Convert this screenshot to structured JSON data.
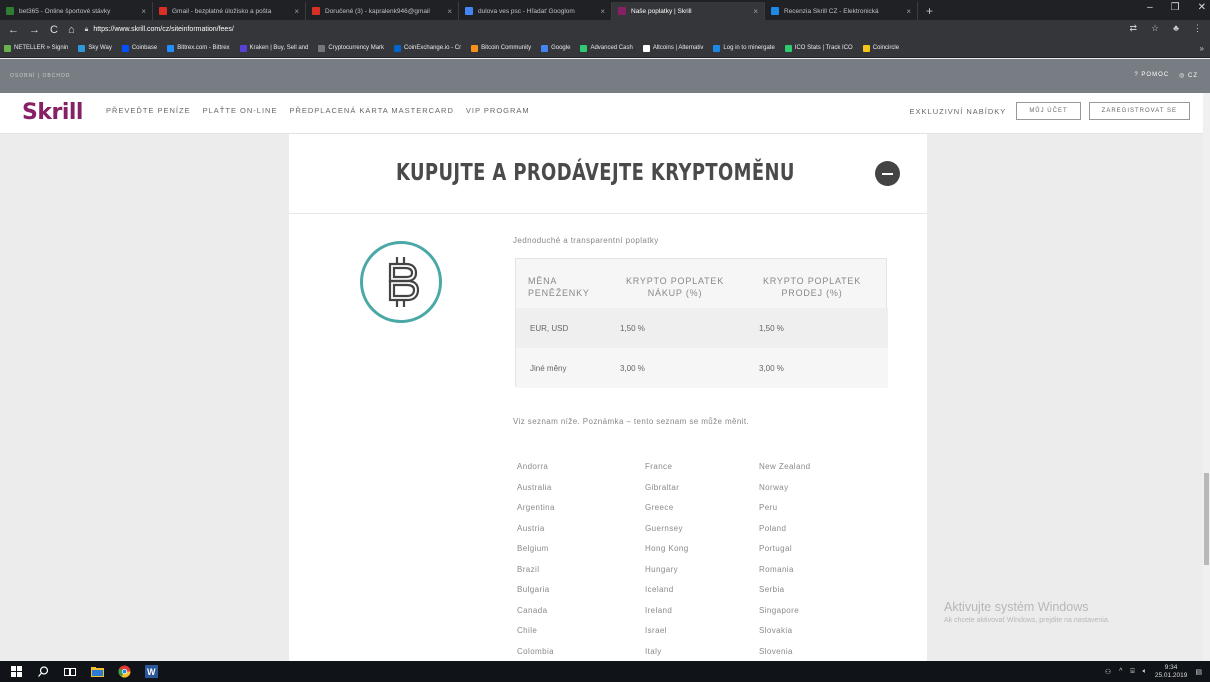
{
  "browser": {
    "tabs": [
      {
        "title": "bet365 - Online športové stávky",
        "fav": "#2e7d32",
        "active": false
      },
      {
        "title": "Gmail - bezplatné úložisko a pošta",
        "fav": "#d93025",
        "active": false
      },
      {
        "title": "Doručené (3) - kapralenk946@gmail",
        "fav": "#d93025",
        "active": false
      },
      {
        "title": "dulova ves psc - Hľadať Googlom",
        "fav": "#4285f4",
        "active": false
      },
      {
        "title": "Naše poplatky | Skrill",
        "fav": "#862165",
        "active": true
      },
      {
        "title": "Recenzia Skrill CZ - Elektronická",
        "fav": "#1e88e5",
        "active": false
      }
    ],
    "new_tab": "+",
    "url": "https://www.skrill.com/cz/siteinformation/fees/",
    "bookmarks": [
      {
        "label": "NETELLER » Signin",
        "color": "#6ab04c"
      },
      {
        "label": "Sky Way",
        "color": "#2d98da"
      },
      {
        "label": "Coinbase",
        "color": "#0052ff"
      },
      {
        "label": "Bittrex.com - Bittrex",
        "color": "#1e90ff"
      },
      {
        "label": "Kraken | Buy, Sell and",
        "color": "#5741d9"
      },
      {
        "label": "Cryptocurrency Mark",
        "color": "#777"
      },
      {
        "label": "CoinExchange.io - Cr",
        "color": "#0066cc"
      },
      {
        "label": "Bitcoin Community",
        "color": "#f7931a"
      },
      {
        "label": "Google",
        "color": "#4285f4"
      },
      {
        "label": "Advanced Cash",
        "color": "#2ecc71"
      },
      {
        "label": "Altcoins | Alternativ",
        "color": "#fff"
      },
      {
        "label": "Log in to minergate",
        "color": "#1e88e5"
      },
      {
        "label": "ICO Stats | Track ICO",
        "color": "#2ecc71"
      },
      {
        "label": "Coincircle",
        "color": "#f5c518"
      }
    ]
  },
  "site": {
    "strip_left": "OSOBNÍ | OBCHOD",
    "strip_help": "POMOC",
    "strip_lang": "CZ",
    "logo": "Skrill",
    "nav": [
      "PŘEVEĎTE PENÍZE",
      "PLAŤTE ON-LINE",
      "PŘEDPLACENÁ KARTA MASTERCARD",
      "VIP PROGRAM"
    ],
    "exclusive": "EXKLUZIVNÍ NABÍDKY",
    "account_button": "MŮJ ÚČET",
    "register_button": "ZAREGISTROVAT SE"
  },
  "section": {
    "title": "KUPUJTE A PRODÁVEJTE KRYPTOMĚNU",
    "intro": "Jednoduché a transparentní poplatky",
    "table": {
      "headers": [
        "MĚNA PENĚŽENKY",
        "KRYPTO POPLATEK NÁKUP (%)",
        "KRYPTO POPLATEK PRODEJ (%)"
      ],
      "rows": [
        [
          "EUR, USD",
          "1,50 %",
          "1,50 %"
        ],
        [
          "Jiné měny",
          "3,00 %",
          "3,00 %"
        ]
      ]
    },
    "note": "Viz seznam níže. Poznámka – tento seznam se může měnit.",
    "countries": {
      "col1": [
        "Andorra",
        "Australia",
        "Argentina",
        "Austria",
        "Belgium",
        "Brazil",
        "Bulgaria",
        "Canada",
        "Chile",
        "Colombia"
      ],
      "col2": [
        "France",
        "Gibraltar",
        "Greece",
        "Guernsey",
        "Hong Kong",
        "Hungary",
        "Iceland",
        "Ireland",
        "Israel",
        "Italy"
      ],
      "col3": [
        "New Zealand",
        "Norway",
        "Peru",
        "Poland",
        "Portugal",
        "Romania",
        "Serbia",
        "Singapore",
        "Slovakia",
        "Slovenia"
      ]
    }
  },
  "windows": {
    "watermark_title": "Aktivujte systém Windows",
    "watermark_sub": "Ak chcete aktivovať Windows, prejdite na nastavenia.",
    "time": "9:34",
    "date": "25.01.2019"
  }
}
